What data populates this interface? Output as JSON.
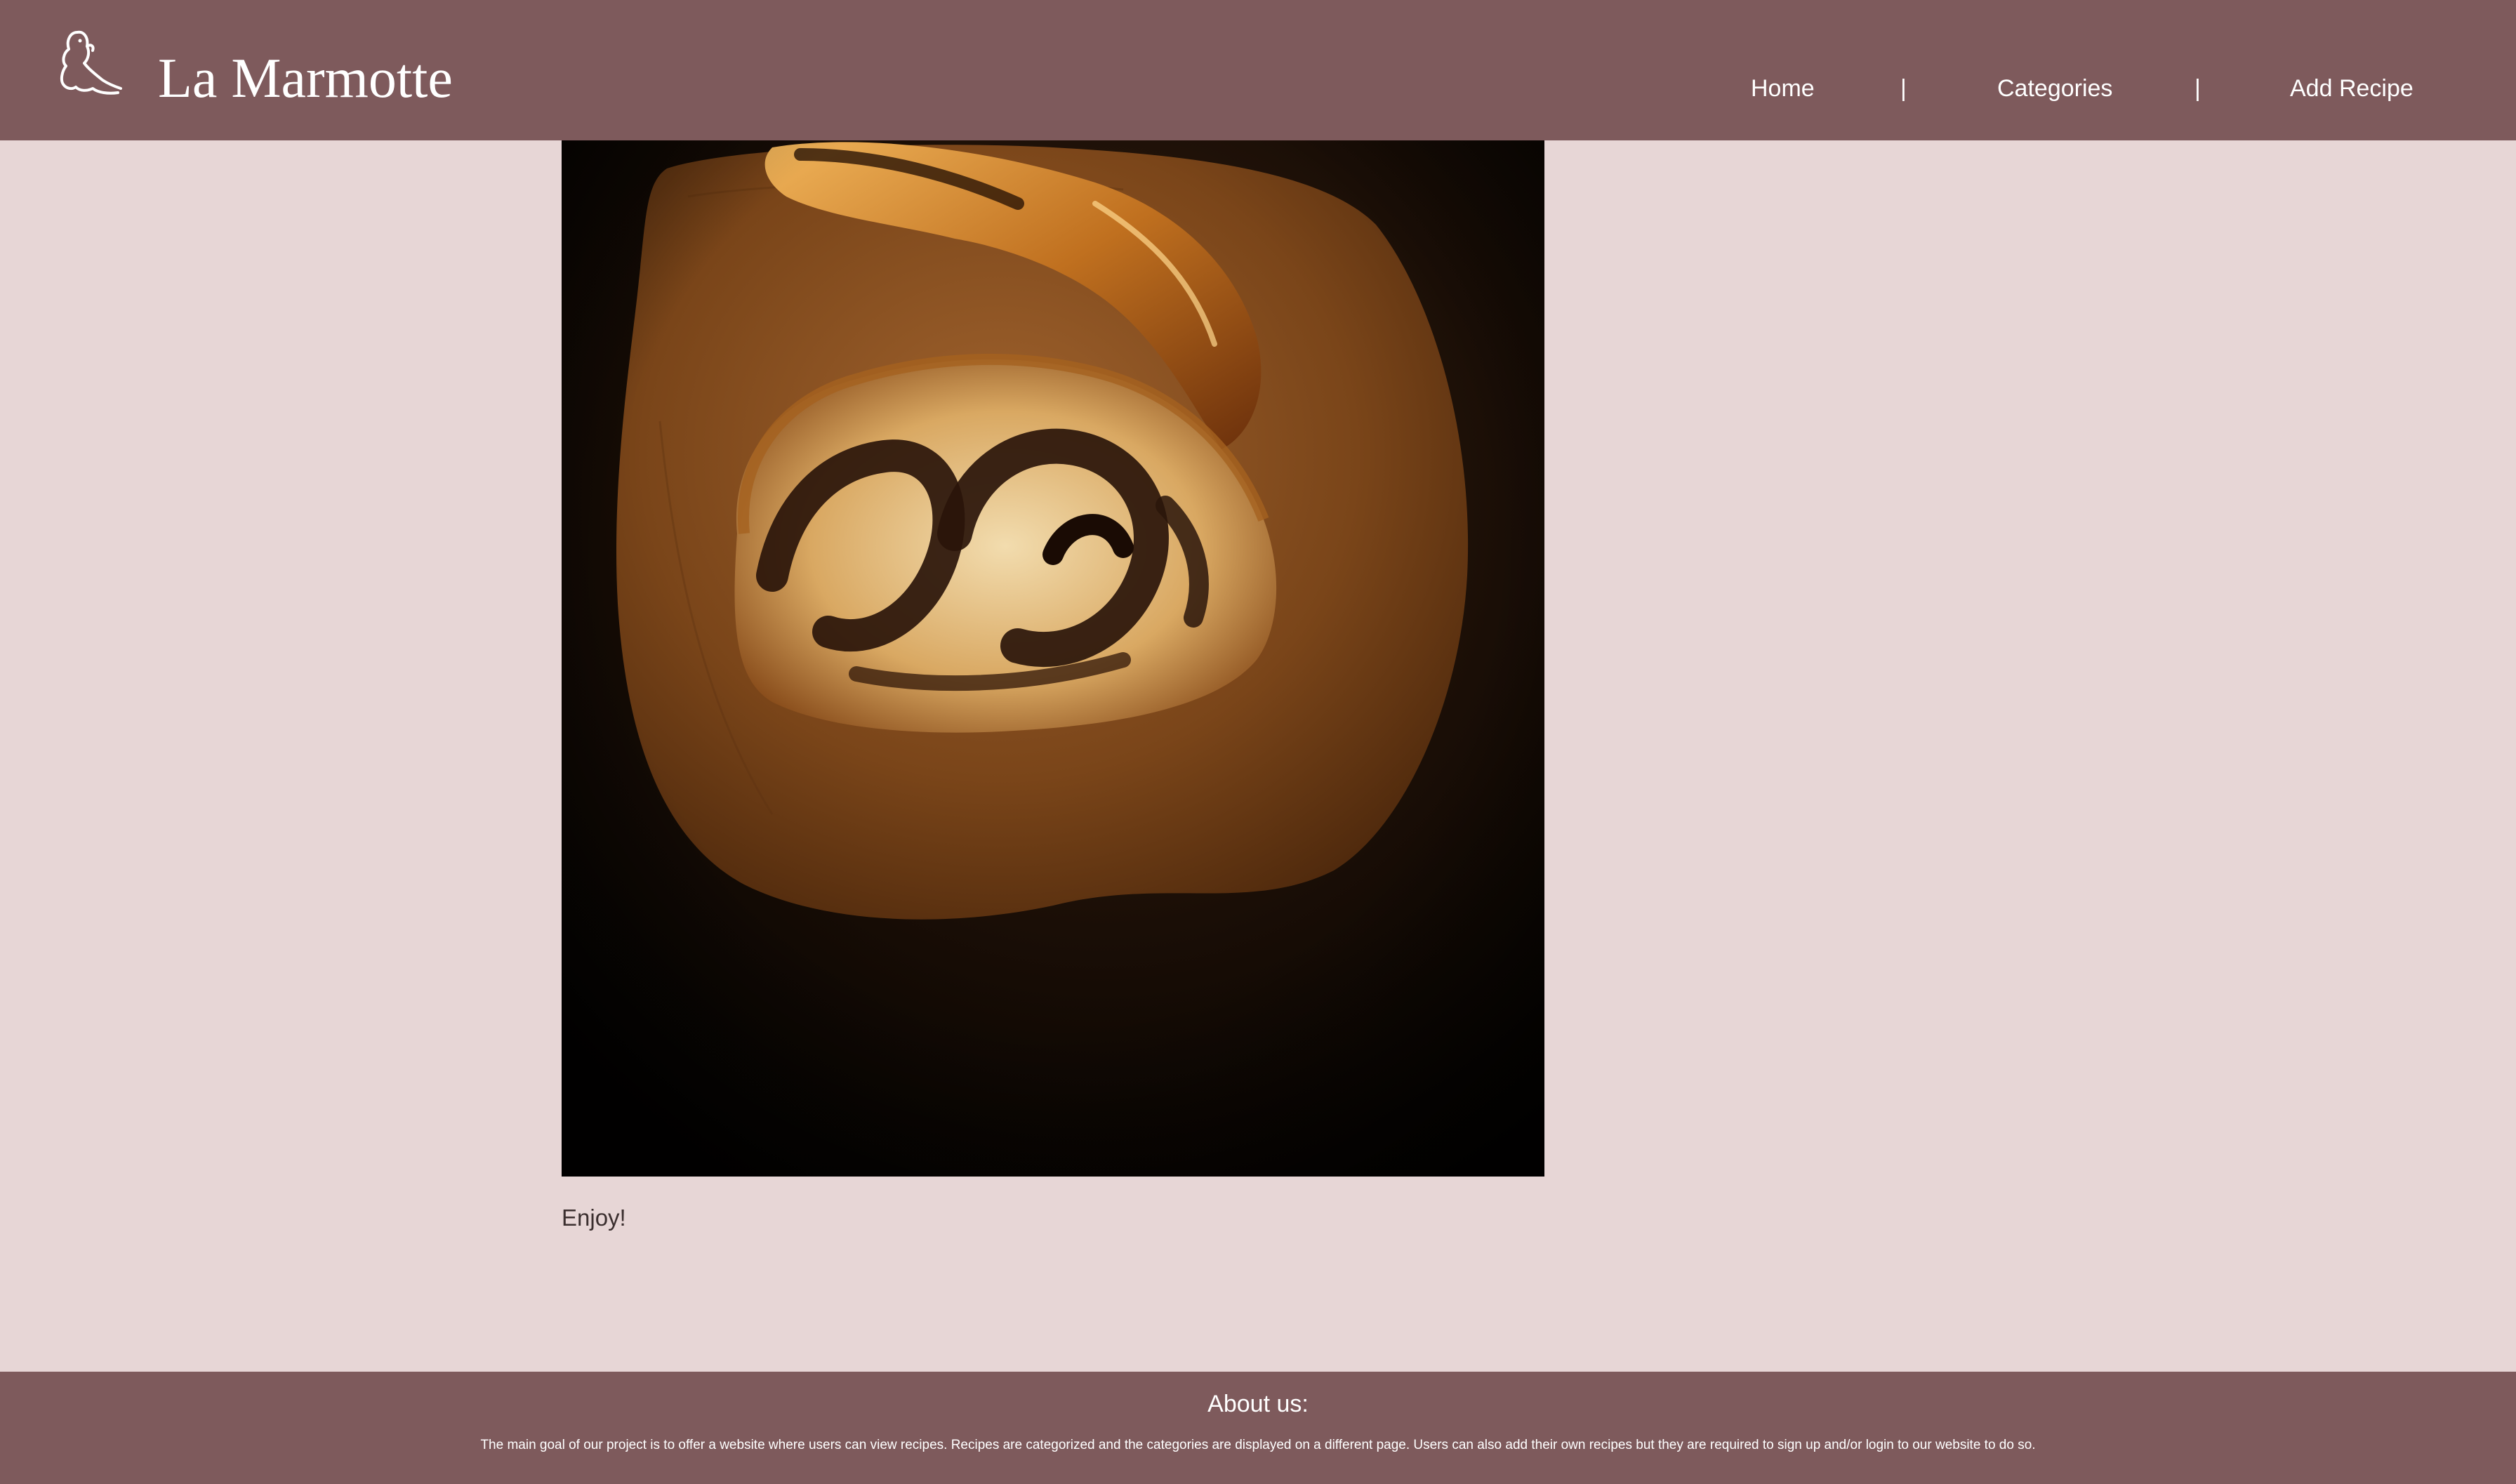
{
  "header": {
    "brand": "La Marmotte",
    "logo_icon": "marmot-outline-icon",
    "nav": {
      "home": "Home",
      "separator_1": "|",
      "categories": "Categories",
      "separator_2": "|",
      "add_recipe": "Add Recipe"
    }
  },
  "main": {
    "image": "babka-bread-photo",
    "caption": "Enjoy!"
  },
  "footer": {
    "title": "About us:",
    "text": "The main goal of our project is to offer a website where users can view recipes. Recipes are categorized and the categories are displayed on a different page. Users can also add their own recipes but they are required to sign up and/or login to our website to do so."
  },
  "colors": {
    "header_bg": "#7e5a5c",
    "page_bg": "#e7d6d6",
    "footer_bg": "#7e5a5c",
    "text_light": "#ffffff",
    "text_dark": "#3b2f2f"
  }
}
